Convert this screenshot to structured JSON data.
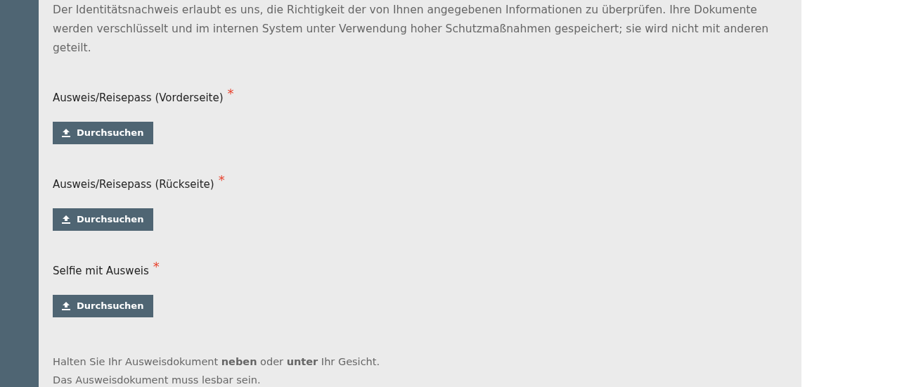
{
  "intro": "Der Identitätsnachweis erlaubt es uns, die Richtigkeit der von Ihnen angegebenen Informationen zu überprüfen. Ihre Dokumente werden verschlüsselt und im internen System unter Verwendung hoher Schutzmaßnahmen gespeichert; sie wird nicht mit anderen geteilt.",
  "fields": [
    {
      "label": "Ausweis/Reisepass (Vorderseite)",
      "required": true,
      "required_mark": "*",
      "button": "Durchsuchen"
    },
    {
      "label": "Ausweis/Reisepass (Rückseite)",
      "required": true,
      "required_mark": "*",
      "button": "Durchsuchen"
    },
    {
      "label": "Selfie mit Ausweis",
      "required": true,
      "required_mark": "*",
      "button": "Durchsuchen"
    }
  ],
  "hints": [
    "Halten Sie Ihr Ausweisdokument **neben** oder **unter** Ihr Gesicht.",
    "Das Ausweisdokument muss lesbar sein."
  ]
}
